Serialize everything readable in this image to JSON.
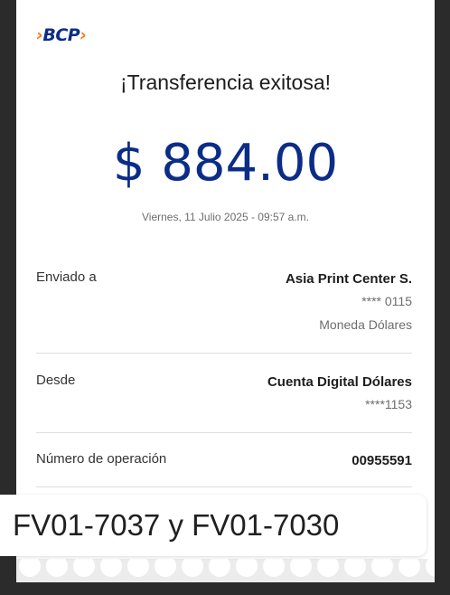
{
  "brand": {
    "logo_text": "BCP",
    "chevron": "›"
  },
  "header": {
    "title": "¡Transferencia exitosa!"
  },
  "amount": {
    "value": "$ 884.00",
    "datetime": "Viernes, 11 Julio 2025 - 09:57 a.m."
  },
  "details": {
    "sent_to": {
      "label": "Enviado a",
      "name": "Asia Print Center S.",
      "account": "**** 0115",
      "currency": "Moneda Dólares"
    },
    "from": {
      "label": "Desde",
      "account_name": "Cuenta Digital Dólares",
      "account_number": "****1153"
    },
    "operation": {
      "label": "Número de operación",
      "number": "00955591"
    }
  },
  "overlay": {
    "text": "FV01-7037 y  FV01-7030"
  },
  "colors": {
    "brand_blue": "#0b2d87",
    "brand_orange": "#f47c20",
    "background": "#2b2b2b"
  }
}
